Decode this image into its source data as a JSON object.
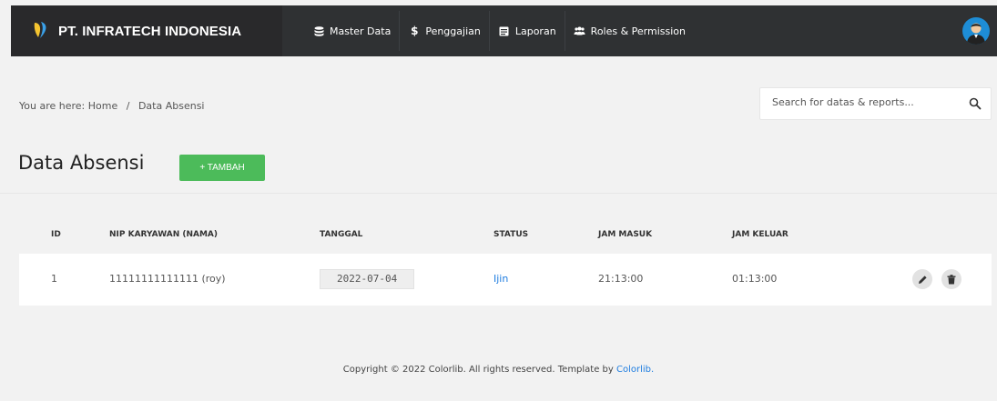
{
  "app": {
    "brand_name": "PT. INFRATECH INDONESIA"
  },
  "nav": {
    "items": [
      {
        "label": "Master Data",
        "icon": "database-icon"
      },
      {
        "label": "Penggajian",
        "icon": "dollar-icon"
      },
      {
        "label": "Laporan",
        "icon": "report-icon"
      },
      {
        "label": "Roles & Permission",
        "icon": "users-icon"
      }
    ]
  },
  "breadcrumb": {
    "prefix": "You are here:",
    "home": "Home",
    "separator": "/",
    "current": "Data Absensi"
  },
  "search": {
    "placeholder": "Search for datas & reports..."
  },
  "page": {
    "title": "Data Absensi",
    "add_button_label": "+ TAMBAH"
  },
  "table": {
    "columns": [
      "ID",
      "NIP KARYAWAN (NAMA)",
      "TANGGAL",
      "STATUS",
      "JAM MASUK",
      "JAM KELUAR"
    ],
    "rows": [
      {
        "id": "1",
        "nip_nama": "11111111111111 (roy)",
        "tanggal": "2022-07-04",
        "status": "Ijin",
        "jam_masuk": "21:13:00",
        "jam_keluar": "01:13:00"
      }
    ]
  },
  "footer": {
    "text": "Copyright © 2022 Colorlib. All rights reserved. Template by",
    "link": "Colorlib."
  },
  "colors": {
    "navbar": "#2f3133",
    "accent_green": "#4cbb5a",
    "link_blue": "#1e7de0",
    "avatar_blue": "#1e8dd6"
  }
}
